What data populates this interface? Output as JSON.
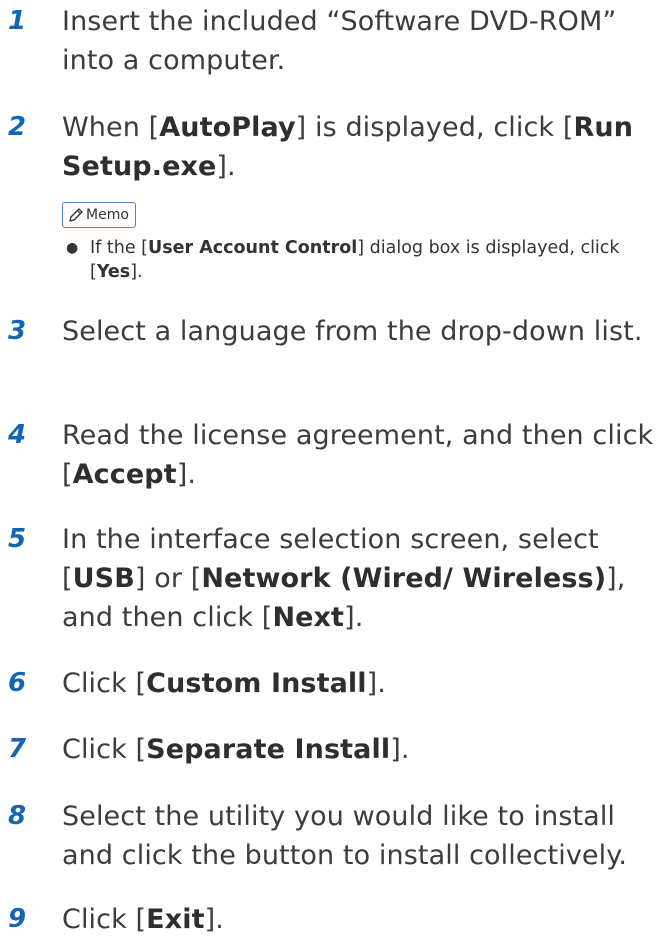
{
  "steps": [
    {
      "number": "1",
      "parts": [
        "Insert the included “Software DVD-ROM” into a computer."
      ]
    },
    {
      "number": "2",
      "parts": [
        "When [",
        "AutoPlay",
        "] is displayed, click [",
        "Run Setup.exe",
        "]."
      ]
    },
    {
      "number": "3",
      "parts": [
        "Select a language from the drop-down list."
      ]
    },
    {
      "number": "4",
      "parts": [
        "Read the license agreement, and then click [",
        "Accept",
        "]."
      ]
    },
    {
      "number": "5",
      "parts": [
        "In the interface selection screen, select [",
        "USB",
        "] or [",
        "Network (Wired/ Wireless)",
        "], and then click [",
        "Next",
        "]."
      ]
    },
    {
      "number": "6",
      "parts": [
        "Click [",
        "Custom Install",
        "]."
      ]
    },
    {
      "number": "7",
      "parts": [
        "Click [",
        "Separate Install",
        "]."
      ]
    },
    {
      "number": "8",
      "parts": [
        "Select the utility you would like to install and click the button to install collectively."
      ]
    },
    {
      "number": "9",
      "parts": [
        "Click [",
        "Exit",
        "]."
      ]
    }
  ],
  "memo": {
    "label": "Memo",
    "icon": "pencil-icon",
    "items": [
      {
        "parts": [
          "If the [",
          "User Account Control",
          "] dialog box is displayed, click [",
          "Yes",
          "]."
        ]
      }
    ]
  },
  "colors": {
    "step_number": "#1565b5",
    "memo_border": "#4a86c5",
    "text": "#3c3c3c"
  }
}
